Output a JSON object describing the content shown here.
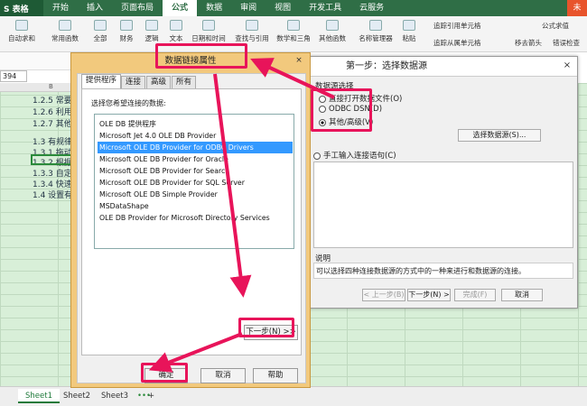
{
  "app": {
    "logo": "S 表格"
  },
  "menu": [
    "开始",
    "插入",
    "页面布局",
    "公式",
    "数据",
    "审阅",
    "视图",
    "开发工具",
    "云服务"
  ],
  "menu_active_index": 3,
  "window_ctrl_text": "未",
  "ribbon": {
    "buttons": [
      "自动求和",
      "常用函数",
      "全部",
      "财务",
      "逻辑",
      "文本",
      "日期和时间",
      "查找与引用",
      "数学和三角",
      "其他函数",
      "名称管理器",
      "粘贴"
    ],
    "right": {
      "trace_precedents": "追踪引用单元格",
      "trace_dependents": "追踪从属单元格",
      "remove_arrows": "移去箭头",
      "show_formula": "公式求值",
      "error_check": "错误检查"
    }
  },
  "name_box": "394",
  "sheet": {
    "column_header": "B",
    "rows": [
      "1.2.5 常要",
      "1.2.6 利用",
      "1.2.7 其他",
      "",
      "1.3 有规律",
      "1.3.1 拖动",
      "1.3.2 根据",
      "1.3.3 自定",
      "1.3.4 快速",
      "1.4 设置有"
    ]
  },
  "sheet_tabs": [
    "Sheet1",
    "Sheet2",
    "Sheet3"
  ],
  "sheet_tab_ellipsis": "•••",
  "sheet_tab_add": "+",
  "wizard": {
    "title": "第一步：选择数据源",
    "group_label": "数据源选择",
    "options": [
      "直接打开数据文件(O)",
      "ODBC DSN(D)",
      "其他/高级(V)"
    ],
    "option_selected_index": 2,
    "select_source_btn": "选择数据源(S)...",
    "manual_option": "手工输入连接语句(C)",
    "note_label": "说明",
    "note_text": "可以选择四种连接数据源的方式中的一种来进行和数据源的连接。",
    "buttons": {
      "prev": "< 上一步(B)",
      "next": "下一步(N) >",
      "finish": "完成(F)",
      "cancel": "取消"
    },
    "close": "×"
  },
  "dialog": {
    "title": "数据链接属性",
    "close": "×",
    "tabs": [
      "提供程序",
      "连接",
      "高级",
      "所有"
    ],
    "active_tab_index": 0,
    "instruction": "选择您希望连接的数据:",
    "providers": [
      "OLE DB 提供程序",
      "Microsoft Jet 4.0 OLE DB Provider",
      "Microsoft OLE DB Provider for ODBC Drivers",
      "Microsoft OLE DB Provider for Oracle",
      "Microsoft OLE DB Provider for Search",
      "Microsoft OLE DB Provider for SQL Server",
      "Microsoft OLE DB Simple Provider",
      "MSDataShape",
      "OLE DB Provider for Microsoft Directory Services"
    ],
    "selected_provider_index": 2,
    "next_btn": "下一步(N) >>",
    "ok_btn": "确定",
    "cancel_btn": "取消",
    "help_btn": "帮助"
  },
  "colors": {
    "highlight": "#e8145a",
    "menu_bg": "#2f6e46",
    "selection": "#3399ff"
  }
}
